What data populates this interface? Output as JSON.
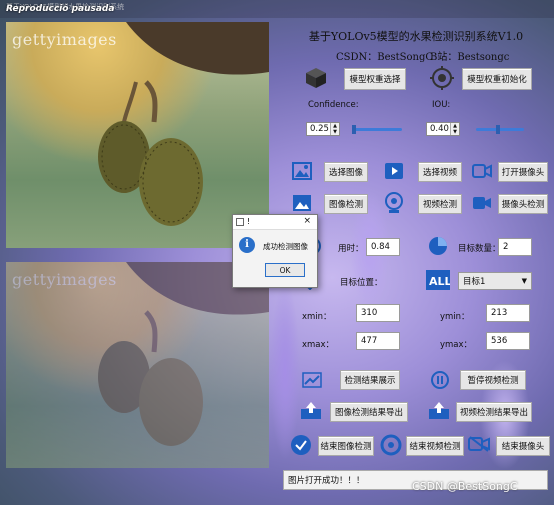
{
  "window": {
    "caption": "Reproducció pausada",
    "caption_sub": "基于YOLOv5模型的水果检测识别系统"
  },
  "image_pane": {
    "watermark_top": "gettyimages",
    "watermark_bottom": "gettyimages"
  },
  "header": {
    "title": "基于YOLOv5模型的水果检测识别系统V1.0",
    "csdn": "CSDN：BestSongC",
    "bilibili": "B站：Bestsongc"
  },
  "model": {
    "select_label": "模型权重选择",
    "init_label": "模型权重初始化",
    "select_icon": "cube-icon",
    "init_icon": "target-icon"
  },
  "params": {
    "confidence_label": "Confidence:",
    "confidence_value": "0.25",
    "iou_label": "IOU:",
    "iou_value": "0.40"
  },
  "actions": {
    "select_image": "选择图像",
    "select_video": "选择视频",
    "open_camera": "打开摄像头",
    "image_detect": "图像检测",
    "video_detect": "视频检测",
    "camera_detect": "摄像头检测"
  },
  "results": {
    "time_label": "用时：",
    "time_value": "0.84",
    "count_label": "目标数量：",
    "count_value": "2",
    "position_label": "目标位置：",
    "target_select": "目标1",
    "xmin_label": "xmin：",
    "xmin_value": "310",
    "ymin_label": "ymin：",
    "ymin_value": "213",
    "xmax_label": "xmax：",
    "xmax_value": "477",
    "ymax_label": "ymax：",
    "ymax_value": "536"
  },
  "bottom_actions": {
    "show_results": "检测结果展示",
    "pause_video": "暂停视频检测",
    "export_image": "图像检测结果导出",
    "export_video": "视频检测结果导出",
    "end_image": "结束图像检测",
    "end_video": "结束视频检测",
    "end_camera": "结束摄像头"
  },
  "status_bar": "图片打开成功！！！",
  "csdn_watermark": "CSDN @BestSongC",
  "dialog": {
    "title": "!",
    "message": "成功检测图像",
    "ok": "OK",
    "close": "×",
    "info_glyph": "i"
  },
  "colors": {
    "accent_blue": "#2a6fc9",
    "slider": "#3d7bd9"
  }
}
